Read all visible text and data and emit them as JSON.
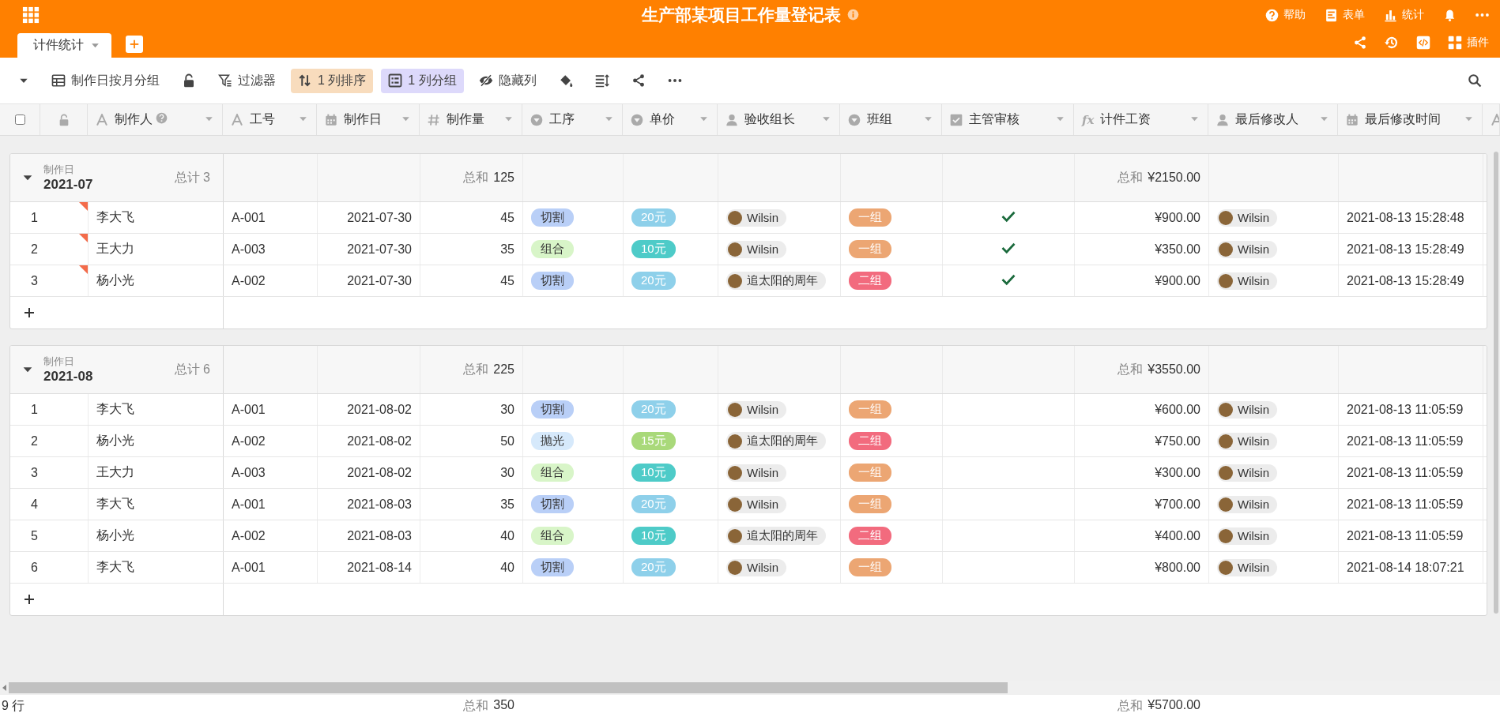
{
  "app_bar": {
    "title": "生产部某项目工作量登记表",
    "actions": [
      {
        "kind": "help",
        "label": "帮助"
      },
      {
        "kind": "form",
        "label": "表单"
      },
      {
        "kind": "stats",
        "label": "统计"
      },
      {
        "kind": "bell"
      },
      {
        "kind": "more"
      }
    ]
  },
  "views": {
    "tabs": [
      {
        "label": "计件统计",
        "selected": true
      }
    ],
    "actions": [
      {
        "kind": "share"
      },
      {
        "kind": "history"
      },
      {
        "kind": "code"
      },
      {
        "kind": "plugin",
        "label": "插件"
      }
    ]
  },
  "toolbar": {
    "items": [
      {
        "kind": "collapse"
      },
      {
        "kind": "view",
        "label": "制作日按月分组"
      },
      {
        "kind": "lock"
      },
      {
        "kind": "filter",
        "label": "过滤器"
      },
      {
        "kind": "sort",
        "label": "1 列排序"
      },
      {
        "kind": "group",
        "label": "1 列分组"
      },
      {
        "kind": "hide",
        "label": "隐藏列"
      },
      {
        "kind": "color"
      },
      {
        "kind": "row-height"
      },
      {
        "kind": "share"
      },
      {
        "kind": "more"
      }
    ]
  },
  "select_all": {
    "checked": false
  },
  "columns": [
    {
      "label": "制作人",
      "kind": "text",
      "help": true
    },
    {
      "label": "工号",
      "kind": "text",
      "help": false
    },
    {
      "label": "制作日",
      "kind": "date",
      "help": false
    },
    {
      "label": "制作量",
      "kind": "number",
      "help": false
    },
    {
      "label": "工序",
      "kind": "select",
      "help": false
    },
    {
      "label": "单价",
      "kind": "select",
      "help": false
    },
    {
      "label": "验收组长",
      "kind": "person",
      "help": false
    },
    {
      "label": "班组",
      "kind": "select",
      "help": false
    },
    {
      "label": "主管审核",
      "kind": "checkbox",
      "help": false
    },
    {
      "label": "计件工资",
      "kind": "formula",
      "glyph": "fx",
      "help": false
    },
    {
      "label": "最后修改人",
      "kind": "person",
      "help": false
    },
    {
      "label": "最后修改时间",
      "kind": "date",
      "help": false
    }
  ],
  "groups": [
    {
      "field": "制作日",
      "value": "2021-07",
      "count": "总计 3",
      "expanded": true,
      "quantity_sum": {
        "label": "总和",
        "value": "125"
      },
      "wage_sum": {
        "label": "总和",
        "value": "¥2150.00"
      },
      "rows": [
        {
          "index": "1",
          "flagged": true,
          "maker": "李大飞",
          "id": "A-001",
          "date": "2021-07-30",
          "quantity": "45",
          "process": {
            "label": "切割",
            "color": "#b9cff7"
          },
          "price": {
            "label": "20元",
            "color": "#8ed0ea"
          },
          "inspector": "Wilsin",
          "team": {
            "label": "一组",
            "color": "#eca673"
          },
          "approved": true,
          "wage": "¥900.00",
          "modifier": "Wilsin",
          "modified_at": "2021-08-13 15:28:48"
        },
        {
          "index": "2",
          "flagged": true,
          "maker": "王大力",
          "id": "A-003",
          "date": "2021-07-30",
          "quantity": "35",
          "process": {
            "label": "组合",
            "color": "#d8f5c8"
          },
          "price": {
            "label": "10元",
            "color": "#4ecbc8"
          },
          "inspector": "Wilsin",
          "team": {
            "label": "一组",
            "color": "#eca673"
          },
          "approved": true,
          "wage": "¥350.00",
          "modifier": "Wilsin",
          "modified_at": "2021-08-13 15:28:49"
        },
        {
          "index": "3",
          "flagged": true,
          "maker": "杨小光",
          "id": "A-002",
          "date": "2021-07-30",
          "quantity": "45",
          "process": {
            "label": "切割",
            "color": "#b9cff7"
          },
          "price": {
            "label": "20元",
            "color": "#8ed0ea"
          },
          "inspector": "追太阳的周年",
          "team": {
            "label": "二组",
            "color": "#f26b7e"
          },
          "approved": true,
          "wage": "¥900.00",
          "modifier": "Wilsin",
          "modified_at": "2021-08-13 15:28:49"
        }
      ]
    },
    {
      "field": "制作日",
      "value": "2021-08",
      "count": "总计 6",
      "expanded": true,
      "quantity_sum": {
        "label": "总和",
        "value": "225"
      },
      "wage_sum": {
        "label": "总和",
        "value": "¥3550.00"
      },
      "rows": [
        {
          "index": "1",
          "flagged": false,
          "maker": "李大飞",
          "id": "A-001",
          "date": "2021-08-02",
          "quantity": "30",
          "process": {
            "label": "切割",
            "color": "#b9cff7"
          },
          "price": {
            "label": "20元",
            "color": "#8ed0ea"
          },
          "inspector": "Wilsin",
          "team": {
            "label": "一组",
            "color": "#eca673"
          },
          "approved": false,
          "wage": "¥600.00",
          "modifier": "Wilsin",
          "modified_at": "2021-08-13 11:05:59"
        },
        {
          "index": "2",
          "flagged": false,
          "maker": "杨小光",
          "id": "A-002",
          "date": "2021-08-02",
          "quantity": "50",
          "process": {
            "label": "抛光",
            "color": "#d6e9fb"
          },
          "price": {
            "label": "15元",
            "color": "#a9d97a"
          },
          "inspector": "追太阳的周年",
          "team": {
            "label": "二组",
            "color": "#f26b7e"
          },
          "approved": false,
          "wage": "¥750.00",
          "modifier": "Wilsin",
          "modified_at": "2021-08-13 11:05:59"
        },
        {
          "index": "3",
          "flagged": false,
          "maker": "王大力",
          "id": "A-003",
          "date": "2021-08-02",
          "quantity": "30",
          "process": {
            "label": "组合",
            "color": "#d8f5c8"
          },
          "price": {
            "label": "10元",
            "color": "#4ecbc8"
          },
          "inspector": "Wilsin",
          "team": {
            "label": "一组",
            "color": "#eca673"
          },
          "approved": false,
          "wage": "¥300.00",
          "modifier": "Wilsin",
          "modified_at": "2021-08-13 11:05:59"
        },
        {
          "index": "4",
          "flagged": false,
          "maker": "李大飞",
          "id": "A-001",
          "date": "2021-08-03",
          "quantity": "35",
          "process": {
            "label": "切割",
            "color": "#b9cff7"
          },
          "price": {
            "label": "20元",
            "color": "#8ed0ea"
          },
          "inspector": "Wilsin",
          "team": {
            "label": "一组",
            "color": "#eca673"
          },
          "approved": false,
          "wage": "¥700.00",
          "modifier": "Wilsin",
          "modified_at": "2021-08-13 11:05:59"
        },
        {
          "index": "5",
          "flagged": false,
          "maker": "杨小光",
          "id": "A-002",
          "date": "2021-08-03",
          "quantity": "40",
          "process": {
            "label": "组合",
            "color": "#d8f5c8"
          },
          "price": {
            "label": "10元",
            "color": "#4ecbc8"
          },
          "inspector": "追太阳的周年",
          "team": {
            "label": "二组",
            "color": "#f26b7e"
          },
          "approved": false,
          "wage": "¥400.00",
          "modifier": "Wilsin",
          "modified_at": "2021-08-13 11:05:59"
        },
        {
          "index": "6",
          "flagged": false,
          "maker": "李大飞",
          "id": "A-001",
          "date": "2021-08-14",
          "quantity": "40",
          "process": {
            "label": "切割",
            "color": "#b9cff7"
          },
          "price": {
            "label": "20元",
            "color": "#8ed0ea"
          },
          "inspector": "Wilsin",
          "team": {
            "label": "一组",
            "color": "#eca673"
          },
          "approved": false,
          "wage": "¥800.00",
          "modifier": "Wilsin",
          "modified_at": "2021-08-14 18:07:21"
        }
      ]
    }
  ],
  "footer": {
    "count": "9 行",
    "quantity_sum": {
      "label": "总和",
      "value": "350"
    },
    "wage_sum": {
      "label": "总和",
      "value": "¥5700.00"
    }
  }
}
